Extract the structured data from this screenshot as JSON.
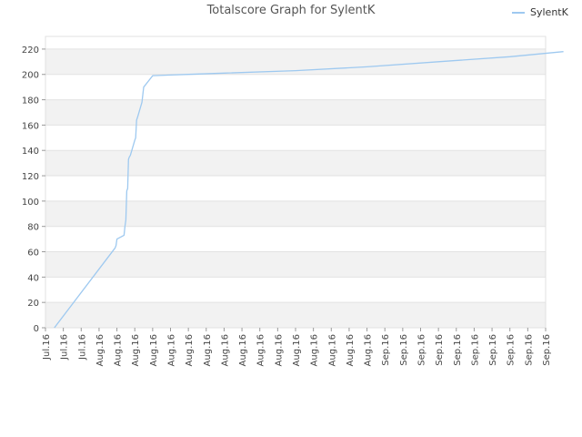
{
  "chart_data": {
    "type": "line",
    "title": "Totalscore Graph for SylentK",
    "legend": {
      "position": "top-right"
    },
    "grid": true,
    "ylim": [
      0,
      230
    ],
    "y_ticks": [
      0,
      20,
      40,
      60,
      80,
      100,
      120,
      140,
      160,
      180,
      200,
      220
    ],
    "x_tick_labels": [
      "Jul.16",
      "Jul.16",
      "Jul.16",
      "Aug.16",
      "Aug.16",
      "Aug.16",
      "Aug.16",
      "Aug.16",
      "Aug.16",
      "Aug.16",
      "Aug.16",
      "Aug.16",
      "Aug.16",
      "Aug.16",
      "Aug.16",
      "Aug.16",
      "Aug.16",
      "Aug.16",
      "Aug.16",
      "Sep.16",
      "Sep.16",
      "Sep.16",
      "Sep.16",
      "Sep.16",
      "Sep.16",
      "Sep.16",
      "Sep.16",
      "Sep.16",
      "Sep.16"
    ],
    "series": [
      {
        "name": "SylentK",
        "color": "#9ec9f0",
        "x": [
          0.5,
          3.9,
          3.95,
          4.0,
          4.4,
          4.45,
          4.5,
          4.55,
          4.6,
          4.65,
          4.7,
          4.75,
          5.0,
          5.05,
          5.1,
          5.15,
          5.4,
          5.5,
          6.0,
          7.0,
          8.0,
          10.0,
          14.0,
          18.0,
          22.0,
          26.0,
          29.0
        ],
        "y": [
          0,
          63,
          65,
          70,
          73,
          80,
          85,
          108,
          110,
          133,
          135,
          136,
          148,
          150,
          164,
          166,
          178,
          190,
          199,
          199.5,
          200,
          201,
          203,
          206,
          210,
          214,
          218
        ]
      }
    ]
  }
}
